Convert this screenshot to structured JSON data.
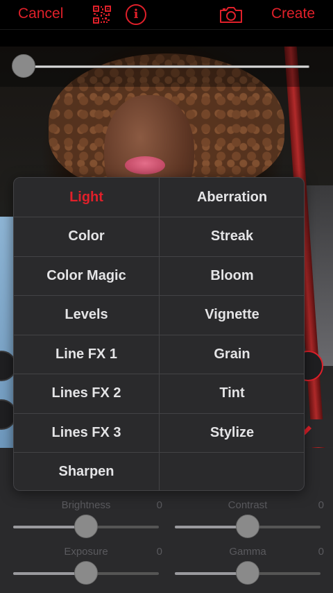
{
  "topbar": {
    "cancel_label": "Cancel",
    "create_label": "Create",
    "info_glyph": "i",
    "icons": [
      "qr-code-icon",
      "info-icon",
      "camera-icon"
    ]
  },
  "intensity_slider": {
    "value_fraction": 0.0
  },
  "menu": {
    "left": [
      "Light",
      "Color",
      "Color Magic",
      "Levels",
      "Line FX 1",
      "Lines FX 2",
      "Lines FX 3",
      "Sharpen"
    ],
    "right": [
      "Aberration",
      "Streak",
      "Bloom",
      "Vignette",
      "Grain",
      "Tint",
      "Stylize",
      ""
    ],
    "selected": "Light"
  },
  "adjustments": {
    "brightness": {
      "label": "Brightness",
      "value": "0",
      "fraction": 0.5
    },
    "contrast": {
      "label": "Contrast",
      "value": "0",
      "fraction": 0.5
    },
    "exposure": {
      "label": "Exposure",
      "value": "0",
      "fraction": 0.5
    },
    "gamma": {
      "label": "Gamma",
      "value": "0",
      "fraction": 0.5
    }
  },
  "colors": {
    "accent": "#e0202a",
    "panel": "#2a2a2c",
    "menu_text": "#e4e4e6"
  }
}
